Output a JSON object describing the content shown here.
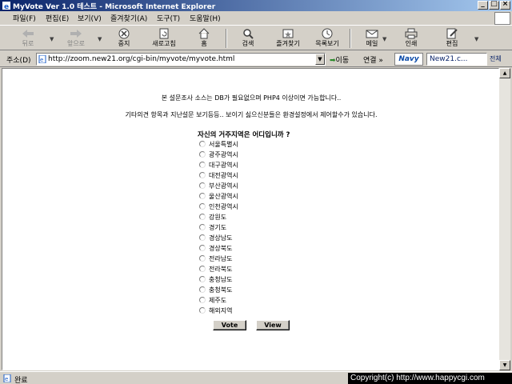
{
  "window": {
    "title": "MyVote Ver 1.0 테스트 - Microsoft Internet Explorer",
    "controls": {
      "minimize": "_",
      "maximize": "□",
      "close": "×"
    }
  },
  "menu": [
    "파일(F)",
    "편집(E)",
    "보기(V)",
    "즐겨찾기(A)",
    "도구(T)",
    "도움말(H)"
  ],
  "toolbar": {
    "back": "뒤로",
    "forward": "앞으로",
    "stop": "중지",
    "refresh": "새로고침",
    "home": "홈",
    "search": "검색",
    "favorites": "즐겨찾기",
    "history": "목록보기",
    "mail": "메일",
    "print": "인쇄",
    "edit": "편집"
  },
  "address": {
    "label": "주소(D)",
    "url": "http://zoom.new21.org/cgi-bin/myvote/myvote.html",
    "go": "이동",
    "links": "연결 »",
    "naver_logo": "Navy",
    "naver_search": "New21.c...",
    "all_search": "전체"
  },
  "page": {
    "notice1": "본 설문조사 소스는 DB가 필요없으며 PHP4 이상이면 가능합니다..",
    "notice2": "기타의견 항목과 지난설문 보기등등.. 보이기 싫으신분들은 환경설정에서 제어할수가 있습니다.",
    "question": "자신의 거주지역은 어디입니까 ?",
    "options": [
      "서울특별시",
      "광주광역시",
      "대구광역시",
      "대전광역시",
      "부산광역시",
      "울산광역시",
      "인천광역시",
      "강원도",
      "경기도",
      "경상남도",
      "경상북도",
      "전라남도",
      "전라북도",
      "충청남도",
      "충청북도",
      "제주도",
      "해외지역"
    ],
    "vote_button": "Vote",
    "view_button": "View"
  },
  "status": {
    "text": "완료"
  },
  "copyright": "Copyright(c) http://www.happycgi.com"
}
